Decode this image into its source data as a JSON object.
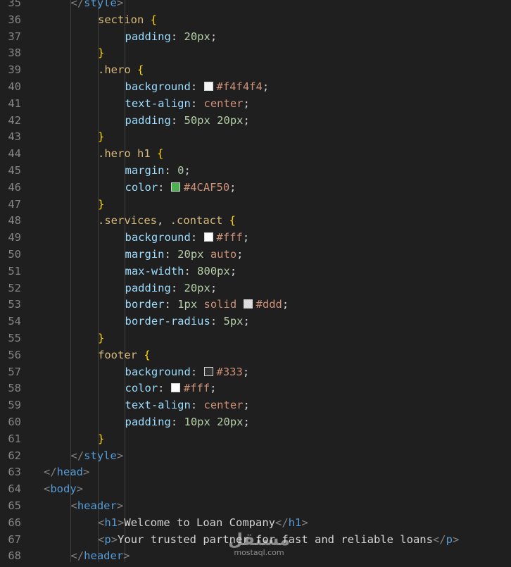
{
  "editor": {
    "theme_background": "#1f1f1f",
    "lines": [
      {
        "n": "35",
        "indent": 2,
        "tokens": [
          [
            "punct",
            "</"
          ],
          [
            "tag",
            "style"
          ],
          [
            "punct",
            ">"
          ]
        ]
      },
      {
        "n": "36",
        "indent": 3,
        "tokens": [
          [
            "sel",
            "section"
          ],
          [
            "txt",
            " "
          ],
          [
            "brace",
            "{"
          ]
        ]
      },
      {
        "n": "37",
        "indent": 4,
        "tokens": [
          [
            "prop",
            "padding"
          ],
          [
            "txt",
            ": "
          ],
          [
            "num",
            "20px"
          ],
          [
            "txt",
            ";"
          ]
        ]
      },
      {
        "n": "38",
        "indent": 3,
        "tokens": [
          [
            "brace",
            "}"
          ]
        ]
      },
      {
        "n": "39",
        "indent": 3,
        "tokens": [
          [
            "sel",
            ".hero"
          ],
          [
            "txt",
            " "
          ],
          [
            "brace",
            "{"
          ]
        ]
      },
      {
        "n": "40",
        "indent": 4,
        "tokens": [
          [
            "prop",
            "background"
          ],
          [
            "txt",
            ": "
          ],
          [
            "swatch",
            "#f4f4f4"
          ],
          [
            "val",
            "#f4f4f4"
          ],
          [
            "txt",
            ";"
          ]
        ]
      },
      {
        "n": "41",
        "indent": 4,
        "tokens": [
          [
            "prop",
            "text-align"
          ],
          [
            "txt",
            ": "
          ],
          [
            "val",
            "center"
          ],
          [
            "txt",
            ";"
          ]
        ]
      },
      {
        "n": "42",
        "indent": 4,
        "tokens": [
          [
            "prop",
            "padding"
          ],
          [
            "txt",
            ": "
          ],
          [
            "num",
            "50px"
          ],
          [
            "txt",
            " "
          ],
          [
            "num",
            "20px"
          ],
          [
            "txt",
            ";"
          ]
        ]
      },
      {
        "n": "43",
        "indent": 3,
        "tokens": [
          [
            "brace",
            "}"
          ]
        ]
      },
      {
        "n": "44",
        "indent": 3,
        "tokens": [
          [
            "sel",
            ".hero"
          ],
          [
            "txt",
            " "
          ],
          [
            "sel",
            "h1"
          ],
          [
            "txt",
            " "
          ],
          [
            "brace",
            "{"
          ]
        ]
      },
      {
        "n": "45",
        "indent": 4,
        "tokens": [
          [
            "prop",
            "margin"
          ],
          [
            "txt",
            ": "
          ],
          [
            "num",
            "0"
          ],
          [
            "txt",
            ";"
          ]
        ]
      },
      {
        "n": "46",
        "indent": 4,
        "tokens": [
          [
            "prop",
            "color"
          ],
          [
            "txt",
            ": "
          ],
          [
            "swatch",
            "#4CAF50"
          ],
          [
            "val",
            "#4CAF50"
          ],
          [
            "txt",
            ";"
          ]
        ]
      },
      {
        "n": "47",
        "indent": 3,
        "tokens": [
          [
            "brace",
            "}"
          ]
        ]
      },
      {
        "n": "48",
        "indent": 3,
        "tokens": [
          [
            "sel",
            ".services"
          ],
          [
            "txt",
            ", "
          ],
          [
            "sel",
            ".contact"
          ],
          [
            "txt",
            " "
          ],
          [
            "brace",
            "{"
          ]
        ]
      },
      {
        "n": "49",
        "indent": 4,
        "tokens": [
          [
            "prop",
            "background"
          ],
          [
            "txt",
            ": "
          ],
          [
            "swatch",
            "#fff"
          ],
          [
            "val",
            "#fff"
          ],
          [
            "txt",
            ";"
          ]
        ]
      },
      {
        "n": "50",
        "indent": 4,
        "tokens": [
          [
            "prop",
            "margin"
          ],
          [
            "txt",
            ": "
          ],
          [
            "num",
            "20px"
          ],
          [
            "txt",
            " "
          ],
          [
            "val",
            "auto"
          ],
          [
            "txt",
            ";"
          ]
        ]
      },
      {
        "n": "51",
        "indent": 4,
        "tokens": [
          [
            "prop",
            "max-width"
          ],
          [
            "txt",
            ": "
          ],
          [
            "num",
            "800px"
          ],
          [
            "txt",
            ";"
          ]
        ]
      },
      {
        "n": "52",
        "indent": 4,
        "tokens": [
          [
            "prop",
            "padding"
          ],
          [
            "txt",
            ": "
          ],
          [
            "num",
            "20px"
          ],
          [
            "txt",
            ";"
          ]
        ]
      },
      {
        "n": "53",
        "indent": 4,
        "tokens": [
          [
            "prop",
            "border"
          ],
          [
            "txt",
            ": "
          ],
          [
            "num",
            "1px"
          ],
          [
            "txt",
            " "
          ],
          [
            "val",
            "solid"
          ],
          [
            "txt",
            " "
          ],
          [
            "swatch",
            "#ddd"
          ],
          [
            "val",
            "#ddd"
          ],
          [
            "txt",
            ";"
          ]
        ]
      },
      {
        "n": "54",
        "indent": 4,
        "tokens": [
          [
            "prop",
            "border-radius"
          ],
          [
            "txt",
            ": "
          ],
          [
            "num",
            "5px"
          ],
          [
            "txt",
            ";"
          ]
        ]
      },
      {
        "n": "55",
        "indent": 3,
        "tokens": [
          [
            "brace",
            "}"
          ]
        ]
      },
      {
        "n": "56",
        "indent": 3,
        "tokens": [
          [
            "sel",
            "footer"
          ],
          [
            "txt",
            " "
          ],
          [
            "brace",
            "{"
          ]
        ]
      },
      {
        "n": "57",
        "indent": 4,
        "tokens": [
          [
            "prop",
            "background"
          ],
          [
            "txt",
            ": "
          ],
          [
            "swatch",
            "#333"
          ],
          [
            "val",
            "#333"
          ],
          [
            "txt",
            ";"
          ]
        ]
      },
      {
        "n": "58",
        "indent": 4,
        "tokens": [
          [
            "prop",
            "color"
          ],
          [
            "txt",
            ": "
          ],
          [
            "swatch",
            "#fff"
          ],
          [
            "val",
            "#fff"
          ],
          [
            "txt",
            ";"
          ]
        ]
      },
      {
        "n": "59",
        "indent": 4,
        "tokens": [
          [
            "prop",
            "text-align"
          ],
          [
            "txt",
            ": "
          ],
          [
            "val",
            "center"
          ],
          [
            "txt",
            ";"
          ]
        ]
      },
      {
        "n": "60",
        "indent": 4,
        "tokens": [
          [
            "prop",
            "padding"
          ],
          [
            "txt",
            ": "
          ],
          [
            "num",
            "10px"
          ],
          [
            "txt",
            " "
          ],
          [
            "num",
            "20px"
          ],
          [
            "txt",
            ";"
          ]
        ]
      },
      {
        "n": "61",
        "indent": 3,
        "tokens": [
          [
            "brace",
            "}"
          ]
        ]
      },
      {
        "n": "62",
        "indent": 2,
        "tokens": [
          [
            "punct",
            "</"
          ],
          [
            "tag",
            "style"
          ],
          [
            "punct",
            ">"
          ]
        ]
      },
      {
        "n": "63",
        "indent": 1,
        "tokens": [
          [
            "punct",
            "</"
          ],
          [
            "tag",
            "head"
          ],
          [
            "punct",
            ">"
          ]
        ]
      },
      {
        "n": "64",
        "indent": 1,
        "tokens": [
          [
            "punct",
            "<"
          ],
          [
            "tag",
            "body"
          ],
          [
            "punct",
            ">"
          ]
        ]
      },
      {
        "n": "65",
        "indent": 2,
        "tokens": [
          [
            "punct",
            "<"
          ],
          [
            "tag",
            "header"
          ],
          [
            "punct",
            ">"
          ]
        ]
      },
      {
        "n": "66",
        "indent": 3,
        "tokens": [
          [
            "punct",
            "<"
          ],
          [
            "tag",
            "h1"
          ],
          [
            "punct",
            ">"
          ],
          [
            "txt",
            "Welcome to Loan Company"
          ],
          [
            "punct",
            "</"
          ],
          [
            "tag",
            "h1"
          ],
          [
            "punct",
            ">"
          ]
        ]
      },
      {
        "n": "67",
        "indent": 3,
        "tokens": [
          [
            "punct",
            "<"
          ],
          [
            "tag",
            "p"
          ],
          [
            "punct",
            ">"
          ],
          [
            "txt",
            "Your trusted partner for fast and reliable loans"
          ],
          [
            "punct",
            "</"
          ],
          [
            "tag",
            "p"
          ],
          [
            "punct",
            ">"
          ]
        ]
      },
      {
        "n": "68",
        "indent": 2,
        "tokens": [
          [
            "punct",
            "</"
          ],
          [
            "tag",
            "header"
          ],
          [
            "punct",
            ">"
          ]
        ]
      }
    ]
  },
  "watermark": {
    "logo": "مستقل",
    "site": "mostaql.com"
  }
}
